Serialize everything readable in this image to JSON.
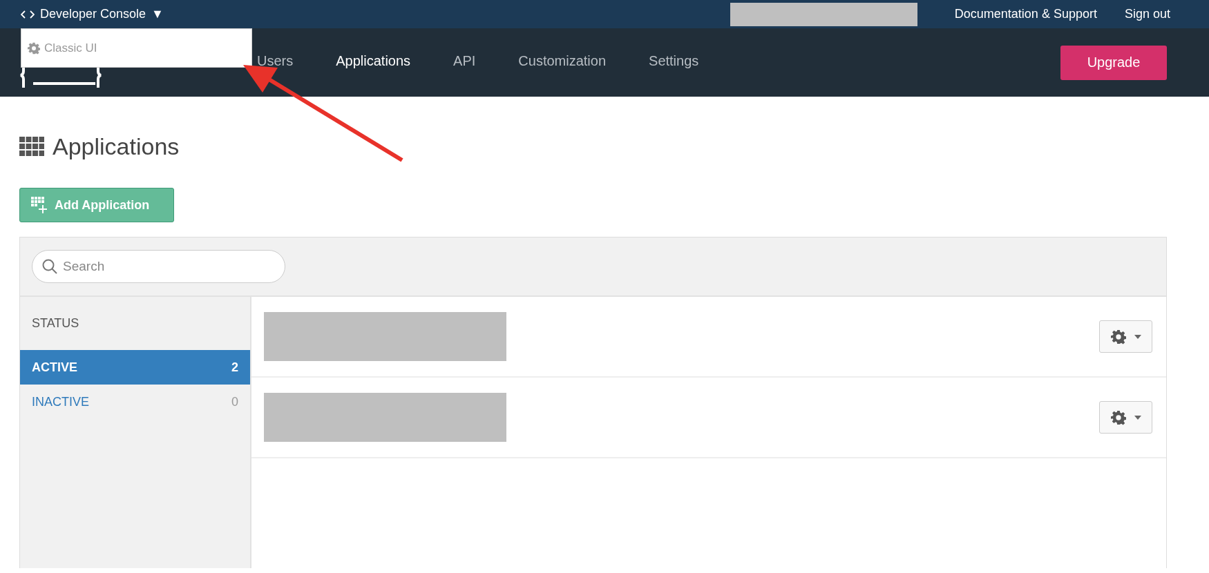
{
  "top_bar": {
    "console_menu": {
      "label": "Developer Console",
      "caret": "▼"
    },
    "account": {
      "kind": "redacted"
    },
    "links": [
      "Documentation & Support",
      "Sign out"
    ]
  },
  "console_dropdown": {
    "items": [
      {
        "label": "Classic UI"
      }
    ]
  },
  "nav": {
    "items": [
      {
        "label": "Users",
        "selected": false
      },
      {
        "label": "Applications",
        "selected": true
      },
      {
        "label": "API",
        "selected": false
      },
      {
        "label": "Customization",
        "selected": false
      },
      {
        "label": "Settings",
        "selected": false
      }
    ],
    "upgrade": "Upgrade"
  },
  "page": {
    "title": "Applications",
    "add_button": "Add Application"
  },
  "search": {
    "placeholder": "Search"
  },
  "status_filter": {
    "heading": "STATUS",
    "items": [
      {
        "label": "ACTIVE",
        "count": "2",
        "selected": true
      },
      {
        "label": "INACTIVE",
        "count": "0",
        "selected": false
      }
    ]
  },
  "app_rows": [
    {
      "kind": "redacted"
    },
    {
      "kind": "redacted"
    }
  ],
  "annotation": {
    "kind": "arrow",
    "color": "#e8322a"
  }
}
